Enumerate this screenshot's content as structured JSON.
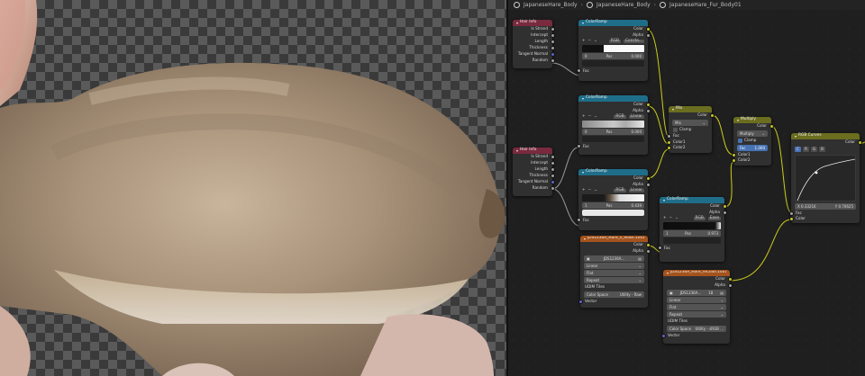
{
  "breadcrumb": [
    "JapaneseHare_Body",
    "JapaneseHare_Body",
    "JapaneseHare_Fur_Body01"
  ],
  "colors": {
    "input_header": "#7a2a3e",
    "converter_header": "#1f6e89",
    "color_header": "#6b6d1f",
    "texture_header": "#a4531d",
    "socket_color": "#c7c729",
    "socket_float": "#a1a1a1",
    "socket_vector": "#6363c7",
    "wire": "#cccc1c"
  },
  "hair_info_1": {
    "title": "Hair Info",
    "outputs": [
      "Is Strand",
      "Intercept",
      "Length",
      "Thickness",
      "Tangent Normal",
      "Random"
    ]
  },
  "hair_info_2": {
    "title": "Hair Info",
    "outputs": [
      "Is Strand",
      "Intercept",
      "Length",
      "Thickness",
      "Tangent Normal",
      "Random"
    ]
  },
  "colorramp_1": {
    "title": "ColorRamp",
    "out_color": "Color",
    "out_alpha": "Alpha",
    "mode": "RGB",
    "interp": "Consta...",
    "index": "0",
    "pos_label": "Pos",
    "pos": "0.000",
    "in_fac": "Fac"
  },
  "colorramp_2": {
    "title": "ColorRamp",
    "out_color": "Color",
    "out_alpha": "Alpha",
    "mode": "RGB",
    "interp": "Linear",
    "index": "0",
    "pos_label": "Pos",
    "pos": "0.000",
    "in_fac": "Fac"
  },
  "colorramp_3": {
    "title": "ColorRamp",
    "out_color": "Color",
    "out_alpha": "Alpha",
    "mode": "RGB",
    "interp": "Linear",
    "index": "1",
    "pos_label": "Pos",
    "pos": "0.439",
    "in_fac": "Fac"
  },
  "colorramp_4": {
    "title": "ColorRamp",
    "out_color": "Color",
    "out_alpha": "Alpha",
    "mode": "RGB",
    "interp": "Ease",
    "index": "1",
    "pos_label": "Pos",
    "pos": "0.973",
    "in_fac": "Fac"
  },
  "mix": {
    "title": "Mix",
    "out": "Color",
    "blend": "Mix",
    "clamp": "Clamp",
    "inputs": [
      "Fac",
      "Color1",
      "Color2"
    ]
  },
  "multiply": {
    "title": "Multiply",
    "out": "Color",
    "blend": "Multiply",
    "clamp": "Clamp",
    "fac_label": "Fac",
    "fac_value": "1.000",
    "inputs": [
      "Color1",
      "Color2"
    ]
  },
  "rgb_curves": {
    "title": "RGB Curves",
    "out": "Color",
    "channels": [
      "C",
      "R",
      "G",
      "B"
    ],
    "x_readout": "X 0.33216",
    "y_readout": "Y 0.70625",
    "inputs": [
      "Fac",
      "Color"
    ]
  },
  "tex_1": {
    "title": "JDS1236A_Hare_n_Mask.1001.png",
    "out_color": "Color",
    "out_alpha": "Alpha",
    "image_name": "JDS1236A...",
    "interp": "Linear",
    "projection": "Flat",
    "extension": "Repeat",
    "udim_label": "UDIM Tiles",
    "cs_label": "Color Space",
    "cs_value": "Utility - Raw",
    "in_vector": "Vector"
  },
  "tex_2": {
    "title": "JDS1236A_Hare_reColor.1001.png",
    "out_color": "Color",
    "out_alpha": "Alpha",
    "image_name": "JDS1236A...",
    "users": "18",
    "interp": "Linear",
    "projection": "Flat",
    "extension": "Repeat",
    "udim_label": "UDIM Tiles",
    "cs_label": "Color Space",
    "cs_value": "Utility - sRGB ...",
    "in_vector": "Vector"
  }
}
